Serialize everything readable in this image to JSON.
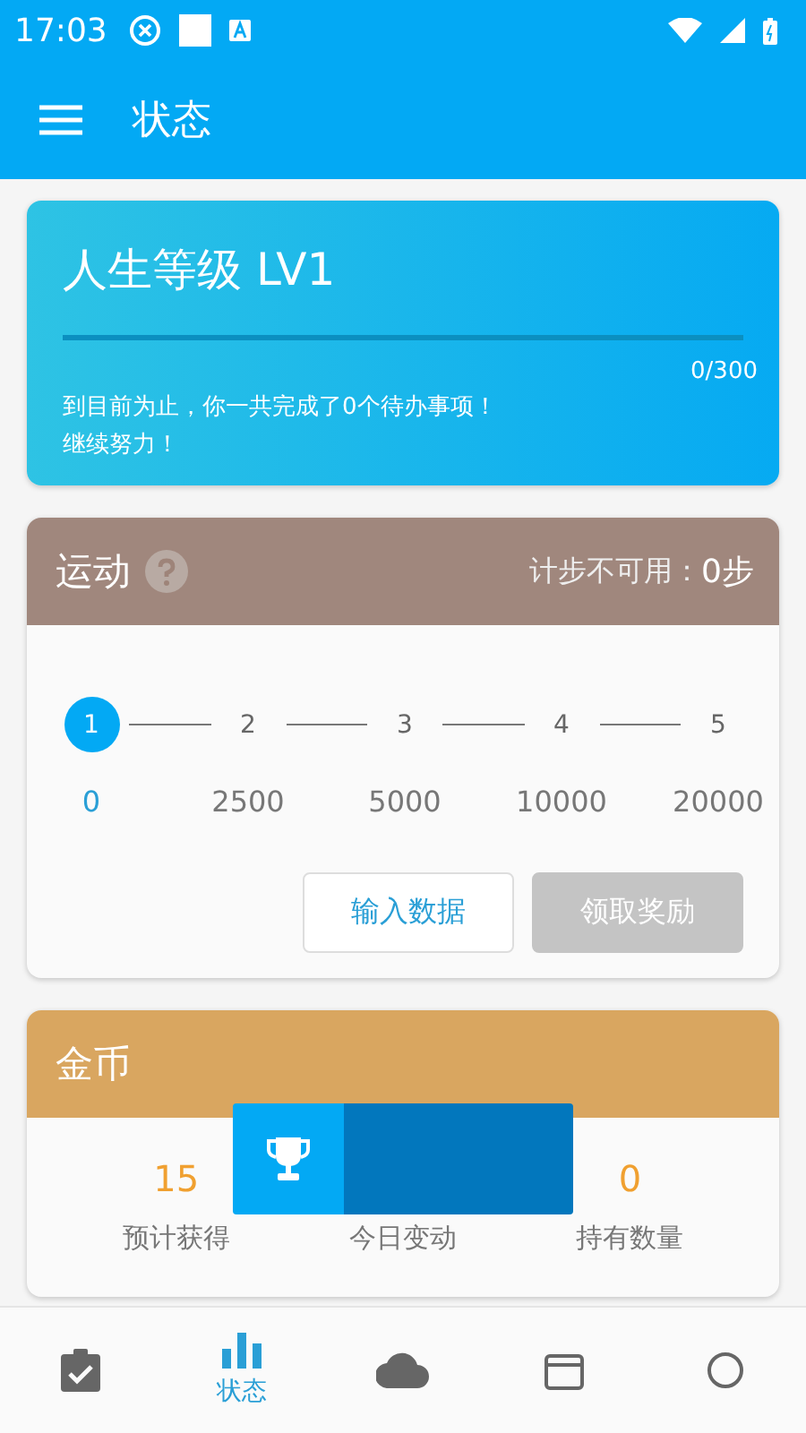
{
  "status_bar": {
    "time": "17:03"
  },
  "app_bar": {
    "title": "状态"
  },
  "level_card": {
    "title": "人生等级 LV1",
    "level": 0,
    "progress": "0/300",
    "message": "到目前为止，你一共完成了0个待办事项！",
    "encourage": "继续努力！"
  },
  "sport_card": {
    "title": "运动",
    "step_label": "计步不可用：",
    "steps": "0步",
    "stages": [
      {
        "number": "1",
        "target": "0",
        "selected": true
      },
      {
        "number": "2",
        "target": "2500",
        "selected": false
      },
      {
        "number": "3",
        "target": "5000",
        "selected": false
      },
      {
        "number": "4",
        "target": "10000",
        "selected": false
      },
      {
        "number": "5",
        "target": "20000",
        "selected": false
      }
    ],
    "buttons": [
      {
        "label": "输入数据",
        "disabled": false
      },
      {
        "label": "领取奖励",
        "disabled": true
      }
    ]
  },
  "coin_card": {
    "title": "金币",
    "stats": [
      {
        "value": "15",
        "label": "预计获得"
      },
      {
        "label": "今日变动"
      },
      {
        "value": "0",
        "label": "持有数量"
      }
    ]
  },
  "bottom_nav": [
    {
      "selected": false
    },
    {
      "label": "状态",
      "selected": true
    },
    {
      "selected": false
    },
    {
      "selected": false
    },
    {
      "selected": false
    }
  ]
}
